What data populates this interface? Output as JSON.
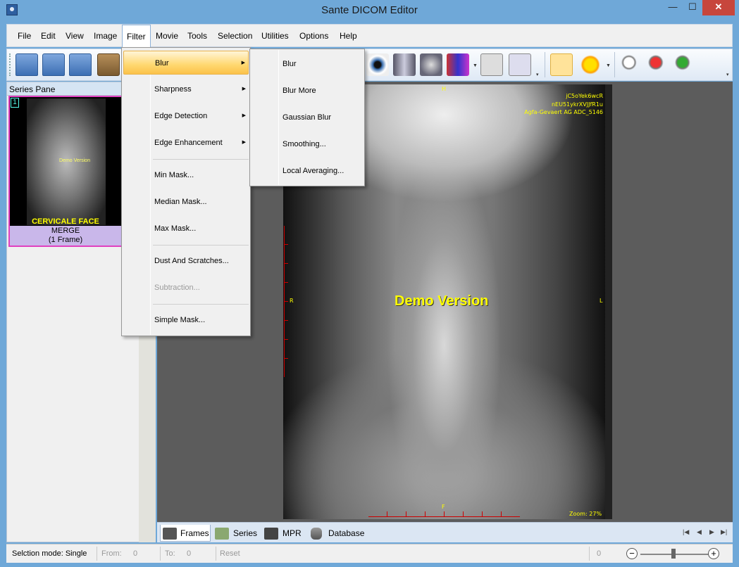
{
  "window": {
    "title": "Sante DICOM Editor",
    "minimize": "—",
    "maximize": "☐",
    "close": "✕"
  },
  "menubar": [
    {
      "label": "File"
    },
    {
      "label": "Edit"
    },
    {
      "label": "View"
    },
    {
      "label": "Image"
    },
    {
      "label": "Filter"
    },
    {
      "label": "Movie"
    },
    {
      "label": "Tools"
    },
    {
      "label": "Selection"
    },
    {
      "label": "Utilities"
    },
    {
      "label": "Options"
    },
    {
      "label": "Help"
    }
  ],
  "series_pane": {
    "header": "Series Pane",
    "thumbnail": {
      "number": "1",
      "demo_text": "Demo Version",
      "face_label": "CERVICALE FACE",
      "series_name": "MERGE",
      "frames": "(1 Frame)"
    }
  },
  "viewer": {
    "overlay_top_right": [
      "jC5oYek6wcR",
      "nEU51ykrXVJJfR1u",
      "Agfa-Gevaert AG ADC_5146"
    ],
    "demo_label": "Demo Version",
    "orientation": {
      "top": "H",
      "bottom": "F",
      "left": "R",
      "right": "L"
    },
    "zoom_label": "Zoom: 27%"
  },
  "tabs": [
    {
      "label": "Frames",
      "active": true
    },
    {
      "label": "Series"
    },
    {
      "label": "MPR"
    },
    {
      "label": "Database"
    }
  ],
  "statusbar": {
    "selection_mode": "Selction mode: Single",
    "from_label": "From:",
    "from_value": "0",
    "to_label": "To:",
    "to_value": "0",
    "reset": "Reset",
    "zoom_value": "0"
  },
  "filter_menu": {
    "items": [
      {
        "label": "Blur",
        "submenu": true,
        "highlighted": true
      },
      {
        "label": "Sharpness",
        "submenu": true
      },
      {
        "label": "Edge Detection",
        "submenu": true
      },
      {
        "label": "Edge Enhancement",
        "submenu": true
      },
      {
        "label": "Min Mask..."
      },
      {
        "label": "Median Mask..."
      },
      {
        "label": "Max Mask..."
      },
      {
        "label": "Dust And Scratches..."
      },
      {
        "label": "Subtraction...",
        "disabled": true
      },
      {
        "label": "Simple Mask..."
      }
    ]
  },
  "blur_submenu": {
    "items": [
      {
        "label": "Blur"
      },
      {
        "label": "Blur More"
      },
      {
        "label": "Gaussian Blur"
      },
      {
        "label": "Smoothing..."
      },
      {
        "label": "Local Averaging..."
      }
    ]
  },
  "icons": [
    "open-folder-icon",
    "folder-icon",
    "save-folder-icon",
    "print-icon",
    "eye-icon",
    "chest-icon",
    "brain-icon",
    "dicom-tag-icon",
    "window-icon",
    "crop-icon",
    "hand-icon",
    "brightness-icon",
    "zoom-icon",
    "zoom-color-icon",
    "zoom-arrow-icon"
  ]
}
